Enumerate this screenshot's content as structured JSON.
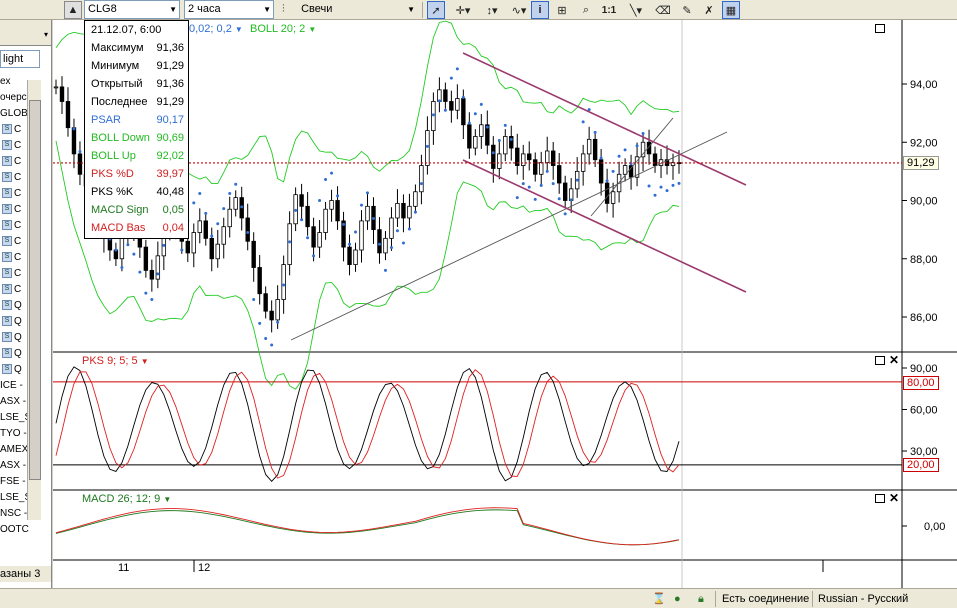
{
  "toolbar": {
    "symbol": "CLG8",
    "interval": "2 часа",
    "chart_style": "Свечи",
    "icons": [
      "up-arrow-icon",
      "cursor-icon",
      "crosshair-icon",
      "wave-tool-icon",
      "info-icon",
      "zoom-icon",
      "zoom-in-icon",
      "zoom-1to1-label",
      "trendline-icon",
      "eraser-icon",
      "draw-tool-icon",
      "properties-icon",
      "grid-icon"
    ],
    "zoom_1to1": "1:1"
  },
  "sidebar": {
    "items": [
      {
        "text": "light",
        "icon": false
      },
      {
        "text": "ex",
        "icon": false
      },
      {
        "text": "очерсс",
        "icon": false
      },
      {
        "text": "GLOB",
        "icon": false
      },
      {
        "text": "C",
        "icon": true
      },
      {
        "text": "C",
        "icon": true
      },
      {
        "text": "C",
        "icon": true
      },
      {
        "text": "C",
        "icon": true
      },
      {
        "text": "C",
        "icon": true
      },
      {
        "text": "C",
        "icon": true
      },
      {
        "text": "C",
        "icon": true
      },
      {
        "text": "C",
        "icon": true
      },
      {
        "text": "C",
        "icon": true
      },
      {
        "text": "C",
        "icon": true
      },
      {
        "text": "C",
        "icon": true
      },
      {
        "text": "Q",
        "icon": true
      },
      {
        "text": "Q",
        "icon": true
      },
      {
        "text": "Q",
        "icon": true
      },
      {
        "text": "Q",
        "icon": true
      },
      {
        "text": "Q",
        "icon": true
      },
      {
        "text": "ICE -",
        "icon": false
      },
      {
        "text": "ASX -",
        "icon": false
      },
      {
        "text": "LSE_S",
        "icon": false
      },
      {
        "text": "TYO -",
        "icon": false
      },
      {
        "text": "AMEX",
        "icon": false
      },
      {
        "text": "ASX -",
        "icon": false
      },
      {
        "text": "FSE -",
        "icon": false
      },
      {
        "text": "LSE_S",
        "icon": false
      },
      {
        "text": "NSC -",
        "icon": false
      },
      {
        "text": "OOTC",
        "icon": false
      }
    ],
    "bottom_label": "азаны 3"
  },
  "data_window": {
    "rows": [
      {
        "label": "21.12.07, 6:00",
        "value": "",
        "color": "#000000"
      },
      {
        "label": "Максимум",
        "value": "91,36",
        "color": "#000000"
      },
      {
        "label": "Минимум",
        "value": "91,29",
        "color": "#000000"
      },
      {
        "label": "Открытый",
        "value": "91,36",
        "color": "#000000"
      },
      {
        "label": "Последнее",
        "value": "91,29",
        "color": "#000000"
      },
      {
        "label": "PSAR",
        "value": "90,17",
        "color": "#2f6fd1"
      },
      {
        "label": "BOLL Down",
        "value": "90,69",
        "color": "#22bb22"
      },
      {
        "label": "BOLL Up",
        "value": "92,02",
        "color": "#22bb22"
      },
      {
        "label": "PKS %D",
        "value": "39,97",
        "color": "#d11f1f"
      },
      {
        "label": "PKS %K",
        "value": "40,48",
        "color": "#000000"
      },
      {
        "label": "MACD Sign",
        "value": "0,05",
        "color": "#1f7a1f"
      },
      {
        "label": "MACD Bas",
        "value": "0,04",
        "color": "#d11f1f"
      }
    ]
  },
  "panes": {
    "main": {
      "indicators_label_psar": "0,02; 0,2",
      "indicators_label_boll": "BOLL 20; 2",
      "y_ticks": [
        "94,00",
        "92,00",
        "90,00",
        "88,00",
        "86,00"
      ],
      "last_price": "91,29"
    },
    "stoch": {
      "label": "PKS 9; 5; 5",
      "y_ticks": [
        "90,00",
        "60,00",
        "30,00"
      ],
      "upper_level": "80,00",
      "lower_level": "20,00"
    },
    "macd": {
      "label": "MACD 26; 12; 9",
      "y_ticks": [
        "0,00"
      ]
    },
    "x_labels": [
      "11",
      "12"
    ]
  },
  "status_bar": {
    "connection": "Есть соединение",
    "language": "Russian - Русский"
  },
  "colors": {
    "up_candle": "#ffffff",
    "down_candle": "#000000",
    "psar": "#2f6fd1",
    "bollinger": "#22cc22",
    "channel": "#9b3a6e",
    "trendline": "#555555",
    "last_price_line": "#cc0000",
    "stoch_k": "#000000",
    "stoch_d": "#e02020",
    "macd_signal": "#1f7a1f",
    "macd_base": "#e02020"
  }
}
